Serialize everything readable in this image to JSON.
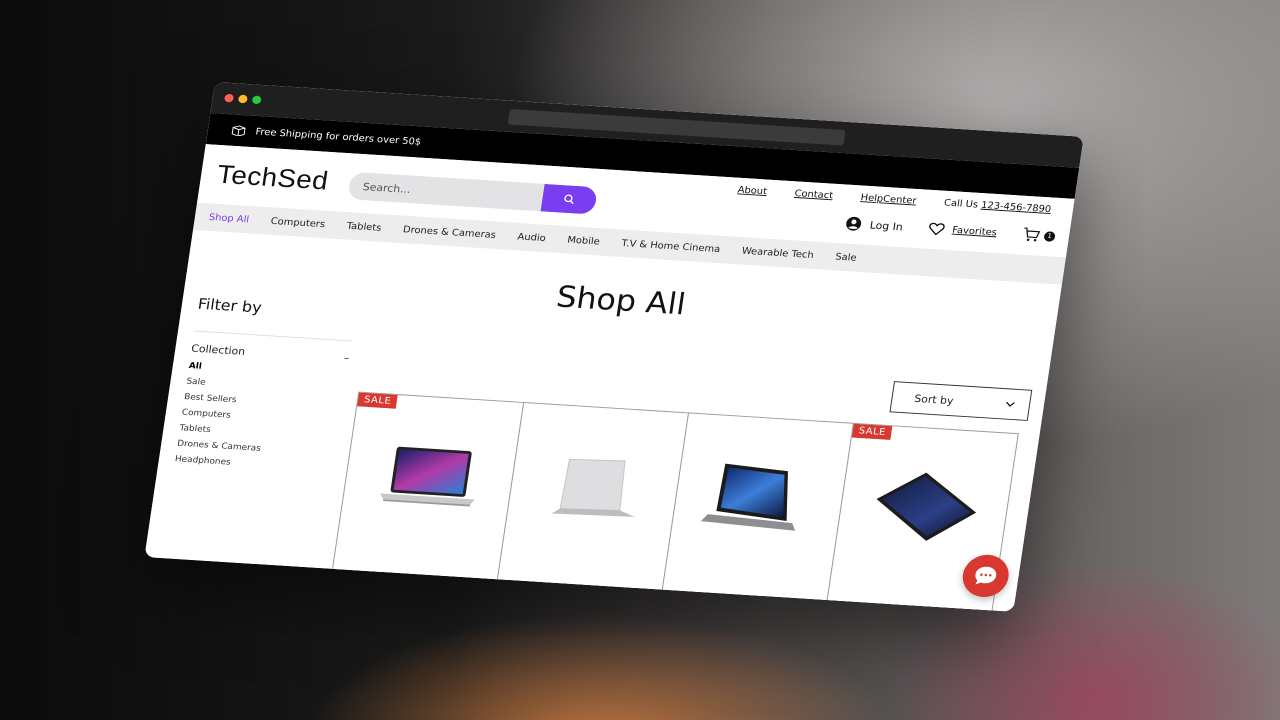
{
  "announcement": {
    "text": "Free Shipping for orders over 50$"
  },
  "brand": {
    "logo": "TechSed"
  },
  "search": {
    "placeholder": "Search..."
  },
  "top_links": {
    "about": "About",
    "contact": "Contact",
    "help": "HelpCenter",
    "call_label": "Call Us",
    "phone": "123-456-7890"
  },
  "account": {
    "login": "Log In",
    "favorites": "Favorites",
    "cart_count": "1"
  },
  "nav": {
    "items": [
      "Shop All",
      "Computers",
      "Tablets",
      "Drones & Cameras",
      "Audio",
      "Mobile",
      "T.V & Home Cinema",
      "Wearable Tech",
      "Sale"
    ]
  },
  "page": {
    "title": "Shop All"
  },
  "filter": {
    "title": "Filter by",
    "collection_label": "Collection",
    "collapse_symbol": "–",
    "items": [
      "All",
      "Sale",
      "Best Sellers",
      "Computers",
      "Tablets",
      "Drones & Cameras",
      "Headphones"
    ]
  },
  "sort": {
    "label": "Sort by"
  },
  "products": [
    {
      "badge": "SALE",
      "image": "laptop-open"
    },
    {
      "badge": "",
      "image": "laptop-closed"
    },
    {
      "badge": "",
      "image": "tablet-with-keyboard"
    },
    {
      "badge": "SALE",
      "image": "tablet"
    }
  ],
  "colors": {
    "accent": "#7a3df0",
    "sale": "#d8382f",
    "topbar": "#000000"
  }
}
